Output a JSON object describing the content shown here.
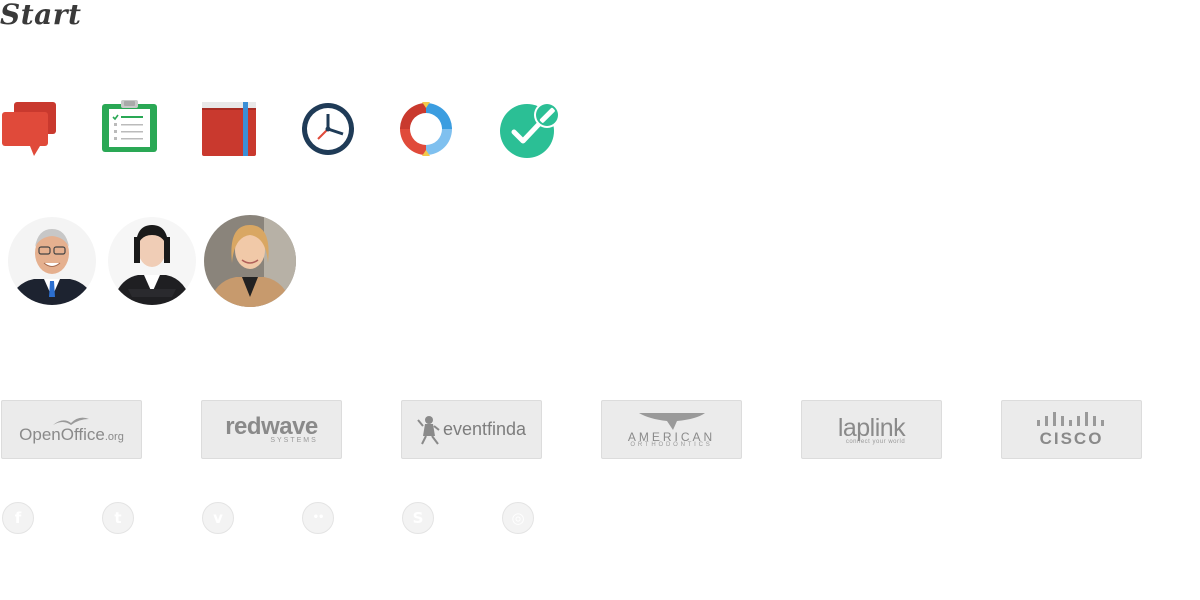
{
  "header": {
    "brand": "Start"
  },
  "icons": [
    {
      "name": "chat-bubbles-icon",
      "color": "#e04a3a"
    },
    {
      "name": "clipboard-checklist-icon",
      "color": "#2aa855"
    },
    {
      "name": "book-icon",
      "color": "#c9392e"
    },
    {
      "name": "clock-icon",
      "color": "#1f3b57"
    },
    {
      "name": "refresh-pencil-icon",
      "color": "#3b9de0"
    },
    {
      "name": "check-edit-icon",
      "color": "#2bbf95"
    }
  ],
  "avatars": [
    {
      "name": "avatar-man-glasses"
    },
    {
      "name": "avatar-woman-dark-hair"
    },
    {
      "name": "avatar-woman-blonde"
    }
  ],
  "logos": {
    "openoffice": {
      "main": "OpenOffice",
      "suffix": ".org"
    },
    "redwave": {
      "main": "redwave",
      "sub": "SYSTEMS"
    },
    "eventfinda": {
      "main": "eventfinda"
    },
    "american": {
      "main": "AMERICAN",
      "sub": "ORTHODONTICS"
    },
    "laplink": {
      "main": "laplink",
      "sub": "connect your world"
    },
    "cisco": {
      "main": "CISCO"
    }
  },
  "social": [
    {
      "name": "facebook-icon",
      "glyph": "f"
    },
    {
      "name": "twitter-icon",
      "glyph": "t"
    },
    {
      "name": "vimeo-icon",
      "glyph": "v"
    },
    {
      "name": "flickr-icon",
      "glyph": "••"
    },
    {
      "name": "skype-icon",
      "glyph": "S"
    },
    {
      "name": "dribbble-icon",
      "glyph": "◎"
    }
  ],
  "colors": {
    "logo_gray": "#8a8a8a",
    "card_bg": "#ebebeb",
    "social_bg": "#f3f3f3"
  }
}
